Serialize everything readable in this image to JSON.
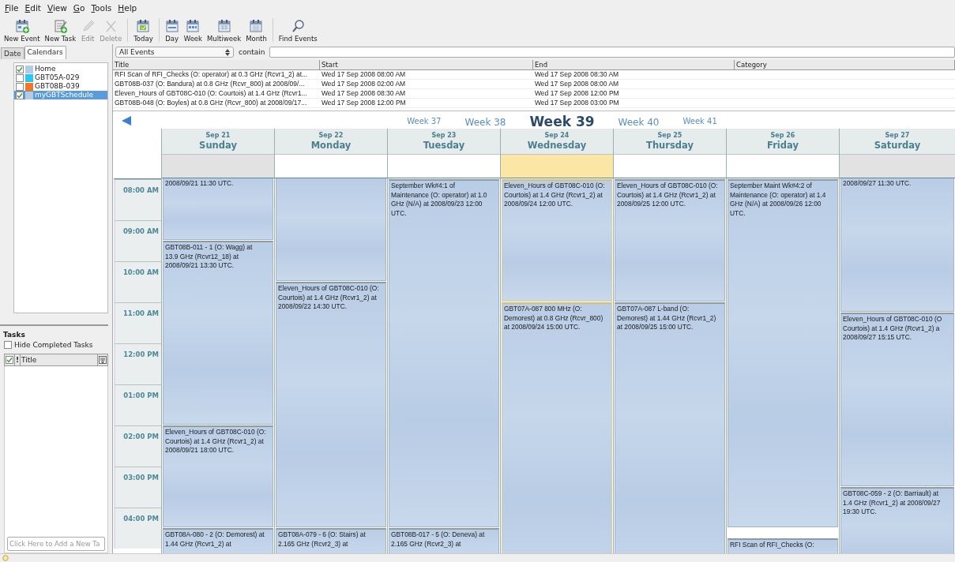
{
  "menu": [
    {
      "label": "File"
    },
    {
      "label": "Edit"
    },
    {
      "label": "View"
    },
    {
      "label": "Go"
    },
    {
      "label": "Tools"
    },
    {
      "label": "Help"
    }
  ],
  "toolbar": [
    [
      {
        "label": "New Event",
        "disabled": false
      },
      {
        "label": "New Task",
        "disabled": false
      },
      {
        "label": "Edit",
        "disabled": true
      },
      {
        "label": "Delete",
        "disabled": true
      }
    ],
    [
      {
        "label": "Today",
        "disabled": false
      }
    ],
    [
      {
        "label": "Day",
        "disabled": false
      },
      {
        "label": "Week",
        "disabled": false
      },
      {
        "label": "Multiweek",
        "disabled": false
      },
      {
        "label": "Month",
        "disabled": false
      }
    ],
    [
      {
        "label": "Find Events",
        "disabled": false
      }
    ]
  ],
  "sidebar": {
    "tabs": [
      {
        "label": "Date",
        "selected": false
      },
      {
        "label": "Calendars",
        "selected": true
      }
    ],
    "calendars": [
      {
        "name": "Home",
        "checked": true,
        "color": "#b4cbe6",
        "selected": false
      },
      {
        "name": "GBT05A-029",
        "checked": false,
        "color": "#2cc6f2",
        "selected": false
      },
      {
        "name": "GBT08B-039",
        "checked": false,
        "color": "#f4761e",
        "selected": false
      },
      {
        "name": "myGBTSchedule",
        "checked": true,
        "color": "#b4cbe6",
        "selected": true
      }
    ],
    "tasks": {
      "title": "Tasks",
      "hide_completed": {
        "label": "Hide Completed Tasks",
        "checked": false
      },
      "header": {
        "checked": true,
        "priority": "!",
        "title": "Title"
      },
      "new_task": {
        "placeholder": "Click Here to Add a New Ta"
      }
    }
  },
  "filter": {
    "scope": "All Events",
    "label": "contain"
  },
  "event_list": {
    "columns": [
      "Title",
      "Start",
      "End",
      "Category"
    ],
    "rows": [
      {
        "title": "RFI Scan of RFI_Checks (O: operator) at 0.3 GHz (Rcvr1_2) at...",
        "start": "Wed 17 Sep 2008 08:00 AM",
        "end": "Wed 17 Sep 2008 08:30 AM"
      },
      {
        "title": "GBT08B-037 (O: Bandura) at 0.8 GHz (Rcvr_800) at 2008/09/...",
        "start": "Wed 17 Sep 2008 02:00 AM",
        "end": "Wed 17 Sep 2008 08:00 AM"
      },
      {
        "title": "Eleven_Hours of GBT08C-010 (O: Courtois) at 1.4 GHz (Rcvr1...",
        "start": "Wed 17 Sep 2008 08:30 AM",
        "end": "Wed 17 Sep 2008 12:00 PM"
      },
      {
        "title": "GBT08B-048 (O: Boyles) at 0.8 GHz (Rcvr_800) at 2008/09/17...",
        "start": "Wed 17 Sep 2008 12:00 PM",
        "end": "Wed 17 Sep 2008 03:00 PM"
      }
    ]
  },
  "week_nav": [
    {
      "label": "Week 37",
      "selected": false
    },
    {
      "label": "Week 38",
      "selected": false
    },
    {
      "label": "Week 39",
      "selected": true
    },
    {
      "label": "Week 40",
      "selected": false
    },
    {
      "label": "Week 41",
      "selected": false
    }
  ],
  "hours": [
    "08:00 AM",
    "09:00 AM",
    "10:00 AM",
    "11:00 AM",
    "12:00 PM",
    "01:00 PM",
    "02:00 PM",
    "03:00 PM",
    "04:00 PM"
  ],
  "days": [
    {
      "date": "Sep 21",
      "name": "Sunday",
      "weekend": true,
      "today": false,
      "events": [
        {
          "lines": [
            "2008/09/21 11:30 UTC."
          ]
        },
        {
          "lines": [
            "GBT08B-011 - 1 (O: Wagg) at",
            "13.9 GHz (Rcvr12_18) at",
            "2008/09/21 13:30 UTC."
          ]
        },
        {
          "lines": [
            "Eleven_Hours of GBT08C-010 (O:",
            "Courtois) at 1.4 GHz (Rcvr1_2) at",
            "2008/09/21 18:00 UTC."
          ]
        },
        {
          "lines": [
            "GBT08A-080 - 2 (O: Demorest) at",
            "1.44 GHz (Rcvr1_2) at"
          ]
        }
      ]
    },
    {
      "date": "Sep 22",
      "name": "Monday",
      "weekend": false,
      "today": false,
      "events": [
        {
          "kind": "event"
        },
        {
          "lines": [
            "Eleven_Hours of GBT08C-010 (O:",
            "Courtois) at 1.4 GHz (Rcvr1_2) at",
            "2008/09/22 14:30 UTC."
          ]
        },
        {
          "lines": [
            "GBT08A-079 - 6 (O: Stairs) at",
            "2.165 GHz (Rcvr2_3) at"
          ]
        }
      ]
    },
    {
      "date": "Sep 23",
      "name": "Tuesday",
      "weekend": false,
      "today": false,
      "events": [
        {
          "lines": [
            "September Wk#4:1 of",
            "Maintenance (O: operator) at 1.0",
            "GHz (N/A) at 2008/09/23 12:00",
            "UTC."
          ]
        },
        {
          "lines": [
            "GBT08B-017 - 5 (O: Deneva) at",
            "2.165 GHz (Rcvr2_3) at"
          ]
        }
      ]
    },
    {
      "date": "Sep 24",
      "name": "Wednesday",
      "weekend": false,
      "today": true,
      "events": [
        {
          "lines": [
            "Eleven_Hours of GBT08C-010 (O:",
            "Courtois) at 1.4 GHz (Rcvr1_2) at",
            "2008/09/24 12:00 UTC."
          ]
        },
        {
          "lines": [
            "GBT07A-087 800 MHz (O:",
            "Demorest) at 0.8 GHz (Rcvr_800)",
            "at 2008/09/24 15:00 UTC."
          ]
        }
      ]
    },
    {
      "date": "Sep 25",
      "name": "Thursday",
      "weekend": false,
      "today": false,
      "events": [
        {
          "lines": [
            "Eleven_Hours of GBT08C-010 (O:",
            "Courtois) at 1.4 GHz (Rcvr1_2) at",
            "2008/09/25 12:00 UTC."
          ]
        },
        {
          "lines": [
            "GBT07A-087 L-band (O:",
            "Demorest) at 1.44 GHz (Rcvr1_2)",
            "at 2008/09/25 15:00 UTC."
          ]
        }
      ]
    },
    {
      "date": "Sep 26",
      "name": "Friday",
      "weekend": false,
      "today": false,
      "events": [
        {
          "lines": [
            "September Maint Wk#4:2 of",
            "Maintenance (O: operator) at 1.4",
            "GHz (N/A) at 2008/09/26 12:00",
            "UTC."
          ]
        },
        {
          "lines": [
            "RFI Scan of RFI_Checks (O:"
          ]
        }
      ]
    },
    {
      "date": "Sep 27",
      "name": "Saturday",
      "weekend": true,
      "today": false,
      "events": [
        {
          "lines": [
            "2008/09/27 11:30 UTC."
          ]
        },
        {
          "lines": [
            "Eleven_Hours of GBT08C-010 (O",
            "Courtois) at 1.4 GHz (Rcvr1_2) a",
            "2008/09/27 15:15 UTC."
          ]
        },
        {
          "lines": [
            "GBT08C-059 - 2 (O: Barriault) at",
            "1.4 GHz (Rcvr1_2) at 2008/09/27",
            "19:30 UTC."
          ]
        }
      ]
    }
  ]
}
